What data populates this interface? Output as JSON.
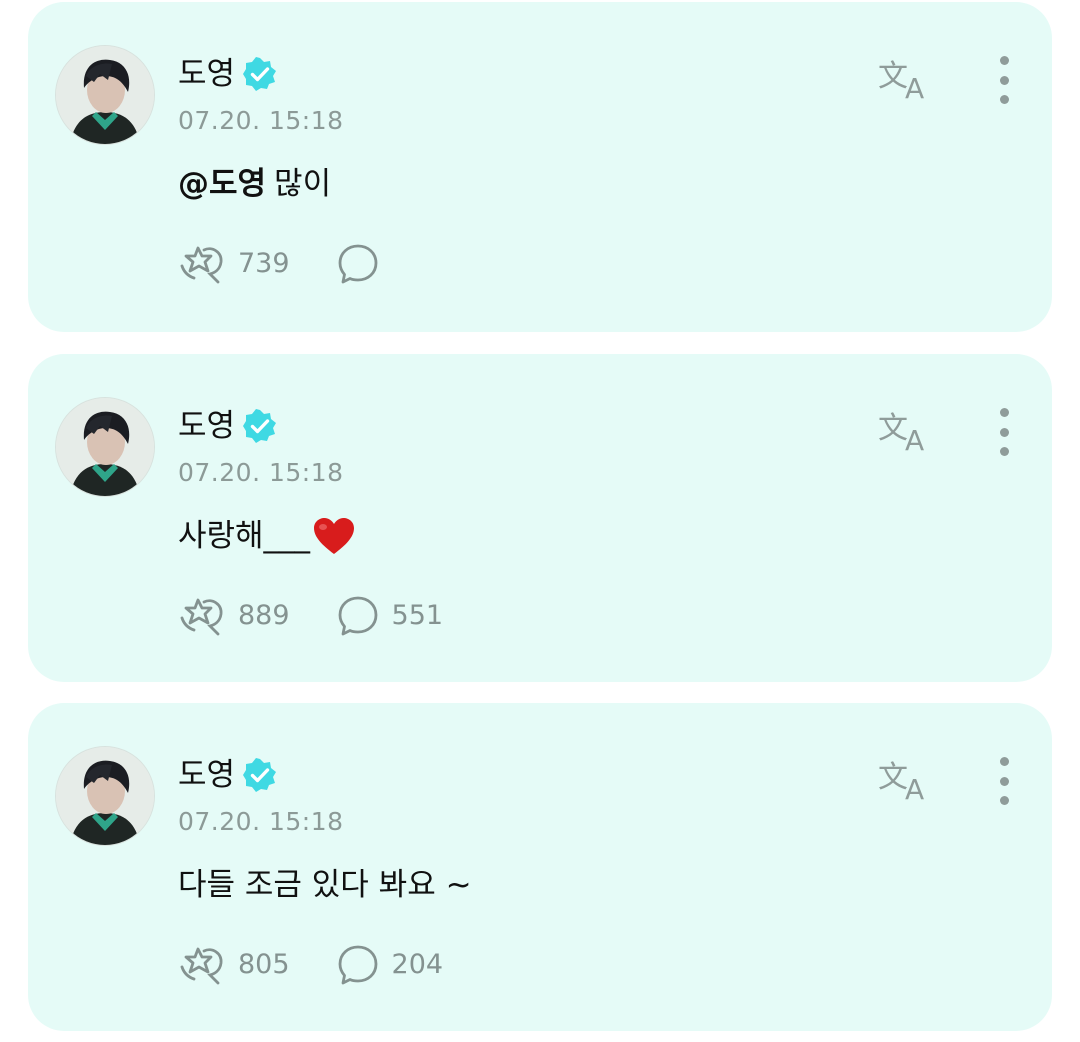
{
  "posts": [
    {
      "author": "도영",
      "time": "07.20. 15:18",
      "mention": "@도영",
      "text": "많이",
      "likes": "739",
      "comments": ""
    },
    {
      "author": "도영",
      "time": "07.20. 15:18",
      "mention": "",
      "text": "사랑해___",
      "likes": "889",
      "comments": "551"
    },
    {
      "author": "도영",
      "time": "07.20. 15:18",
      "mention": "",
      "text": "다들 조금 있다 봐요 ~",
      "likes": "805",
      "comments": "204"
    }
  ],
  "icons": {
    "verified": "verified-check-icon",
    "translate": "translate-icon",
    "more": "more-vertical-icon",
    "like": "cheer-star-hand-icon",
    "comment": "comment-bubble-icon",
    "heart": "red-heart-emoji"
  },
  "colors": {
    "card_bg": "#e5fbf7",
    "verified": "#3fd9e3",
    "muted": "#849290",
    "heart": "#d81c1c"
  }
}
